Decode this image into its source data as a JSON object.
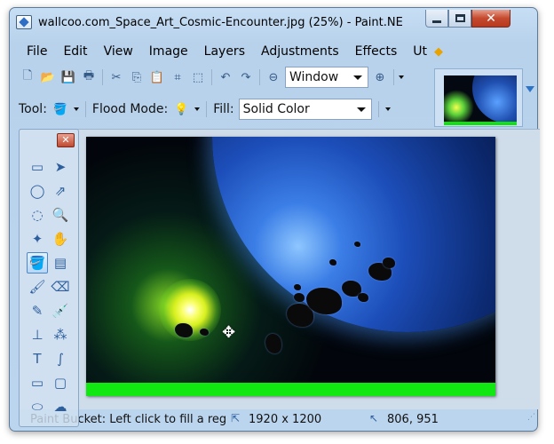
{
  "window": {
    "title": "wallcoo.com_Space_Art_Cosmic-Encounter.jpg (25%) - Paint.NE",
    "minimize_icon": "minimize-icon",
    "maximize_icon": "maximize-icon",
    "close_symbol": "✕"
  },
  "menubar": {
    "items": [
      "File",
      "Edit",
      "View",
      "Image",
      "Layers",
      "Adjustments",
      "Effects",
      "Ut"
    ],
    "overflow_symbol": "◆"
  },
  "toolbar": {
    "icons": [
      "new-icon",
      "open-icon",
      "save-icon",
      "print-icon",
      "cut-icon",
      "copy-icon",
      "paste-icon",
      "crop-icon",
      "deselect-icon",
      "undo-icon",
      "redo-icon",
      "zoom-out-icon",
      "zoom-in-icon"
    ],
    "zoom_value": "Window"
  },
  "toolbar2": {
    "tool_label": "Tool:",
    "flood_label": "Flood Mode:",
    "fill_label": "Fill:",
    "fill_value": "Solid Color"
  },
  "tools_panel": {
    "close_symbol": "✕",
    "tools": [
      "rectangle-select-icon",
      "move-selection-icon",
      "lasso-select-icon",
      "move-selected-icon",
      "ellipse-select-icon",
      "zoom-icon",
      "magic-wand-icon",
      "pan-icon",
      "paint-bucket-icon",
      "gradient-icon",
      "paintbrush-icon",
      "eraser-icon",
      "pencil-icon",
      "color-picker-icon",
      "clone-stamp-icon",
      "recolor-icon",
      "text-icon",
      "line-curve-icon",
      "rectangle-icon",
      "rounded-rectangle-icon",
      "ellipse-icon",
      "freeform-shape-icon"
    ],
    "active_tool": "paint-bucket-icon"
  },
  "status": {
    "hint": "Paint Bucket: Left click to fill a region",
    "image_size": "1920 x 1200",
    "cursor_position": "806, 951"
  },
  "colors": {
    "accent": "#2e74c6",
    "chrome": "#bcd5ee",
    "image_band": "#11e811"
  }
}
